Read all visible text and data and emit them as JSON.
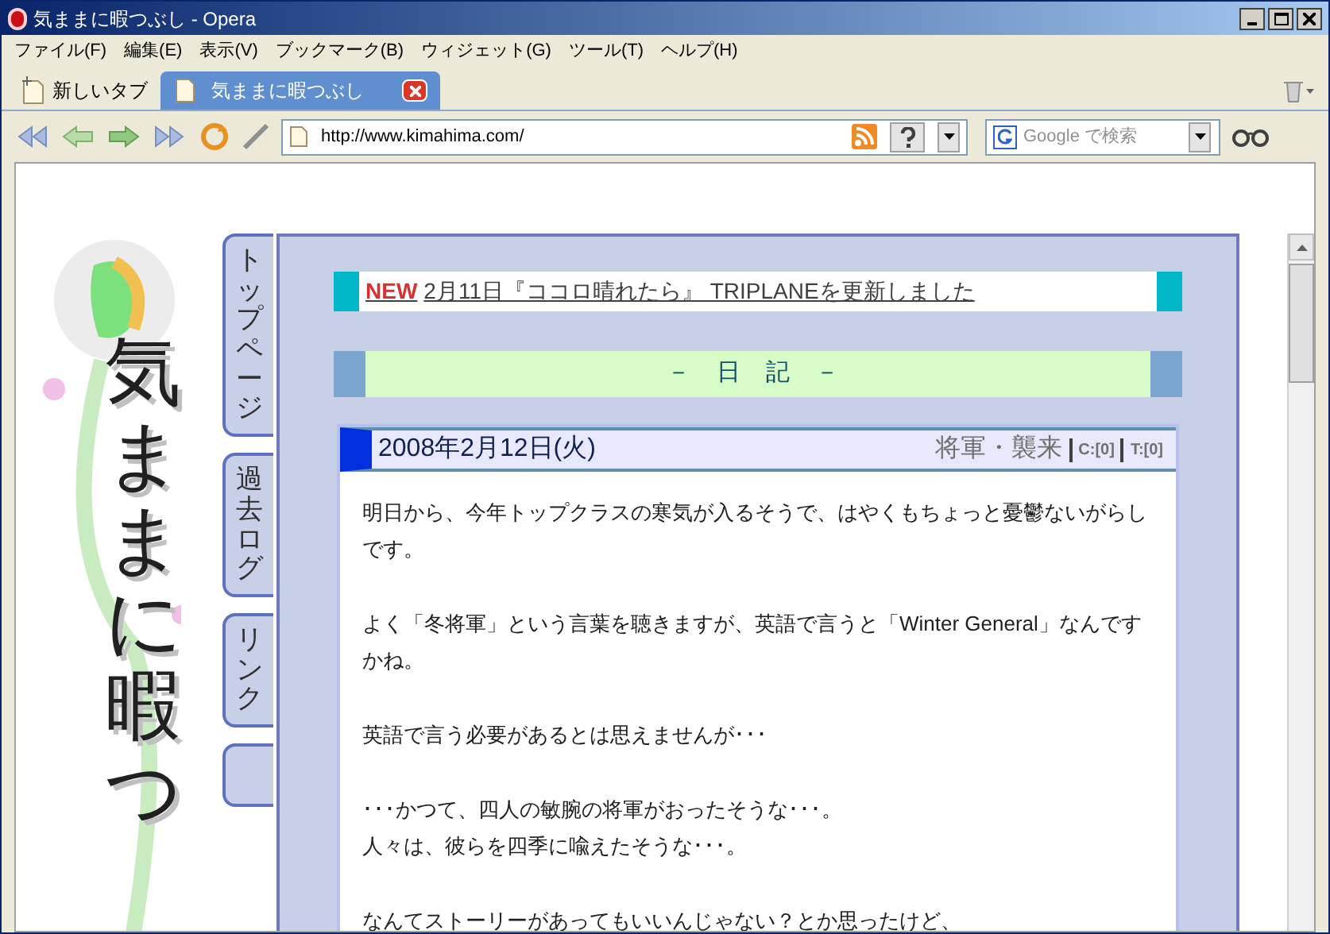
{
  "window": {
    "title": "気ままに暇つぶし - Opera"
  },
  "menu": [
    "ファイル(F)",
    "編集(E)",
    "表示(V)",
    "ブックマーク(B)",
    "ウィジェット(G)",
    "ツール(T)",
    "ヘルプ(H)"
  ],
  "tabs": [
    {
      "label": "新しいタブ",
      "kind": "new",
      "selected": false
    },
    {
      "label": "気ままに暇つぶし",
      "kind": "page",
      "selected": true
    }
  ],
  "address": {
    "value": "http://www.kimahima.com/"
  },
  "search": {
    "placeholder": "Google で検索"
  },
  "site": {
    "title": "気ままに暇つ",
    "nav": [
      "トップページ",
      "過去ログ",
      "リンク"
    ],
    "news": {
      "badge": "NEW",
      "text": "2月11日『ココロ晴れたら』 TRIPLANEを更新しました"
    },
    "section": "－ 日 記 －",
    "entry": {
      "date": "2008年2月12日(火)",
      "title": "将軍・襲来",
      "comments": "C:[0]",
      "trackbacks": "T:[0]",
      "paragraphs": [
        [
          "明日から、今年トップクラスの寒気が入るそうで、はやくもちょっと憂鬱ないがらしです。"
        ],
        [
          "よく「冬将軍」という言葉を聴きますが、英語で言うと「Winter General」なんですかね。"
        ],
        [
          "英語で言う必要があるとは思えませんが･･･"
        ],
        [
          "･･･かつて、四人の敏腕の将軍がおったそうな･･･。",
          "人々は、彼らを四季に喩えたそうな･･･。"
        ],
        [
          "なんてストーリーがあってもいいんじゃない？とか思ったけど、"
        ]
      ]
    }
  }
}
